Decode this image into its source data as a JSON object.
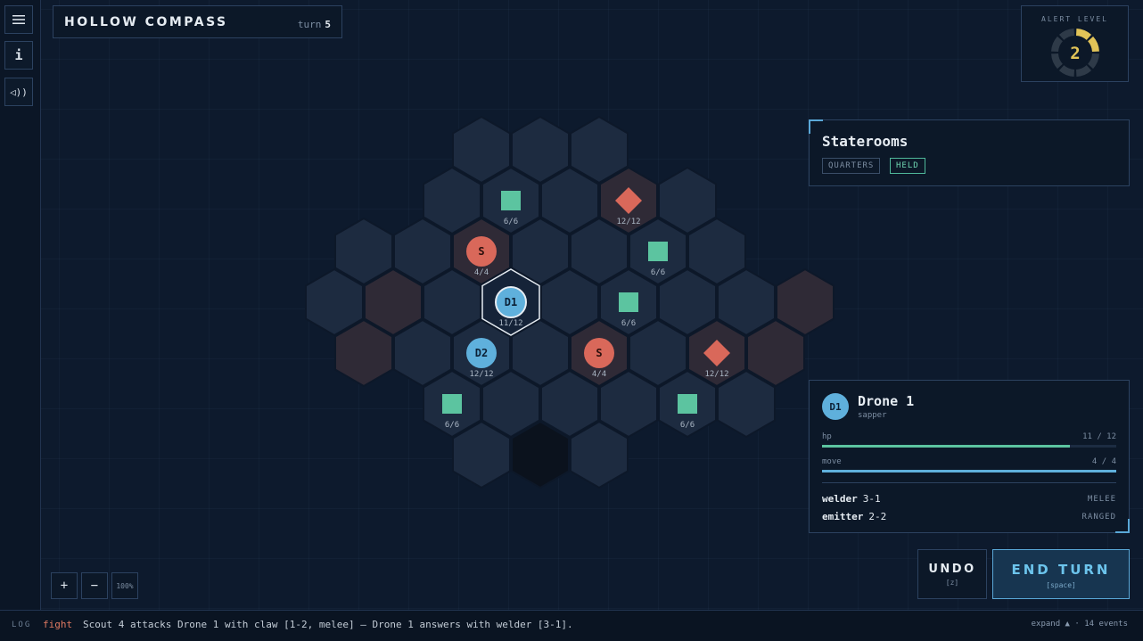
{
  "header": {
    "title": "HOLLOW COMPASS",
    "turn_label": "turn",
    "turn_value": "5"
  },
  "sidebar": {
    "menu_icon": "menu-icon",
    "info_label": "i",
    "sound_label": "◁))"
  },
  "alert": {
    "label": "ALERT LEVEL",
    "level": "2",
    "level_value": 2,
    "max": 8
  },
  "room": {
    "name": "Staterooms",
    "tags": [
      "QUARTERS",
      "HELD"
    ]
  },
  "selected_unit": {
    "badge": "D1",
    "name": "Drone 1",
    "role": "sapper",
    "hp_label": "hp",
    "hp_text": "11 / 12",
    "hp": 11,
    "hp_max": 12,
    "move_label": "move",
    "move_text": "4 / 4",
    "move": 4,
    "move_max": 4,
    "weapons": [
      {
        "name": "welder",
        "stat": "3-1",
        "type": "MELEE"
      },
      {
        "name": "emitter",
        "stat": "2-2",
        "type": "RANGED"
      }
    ]
  },
  "actions": {
    "undo_label": "UNDO",
    "undo_key": "[z]",
    "end_label": "END TURN",
    "end_key": "[space]"
  },
  "zoom": {
    "in_label": "+",
    "out_label": "−",
    "level": "100%"
  },
  "log": {
    "label": "LOG",
    "kind": "fight",
    "message": "Scout 4 attacks Drone 1 with claw [1-2, melee] — Drone 1 answers with welder [3-1].",
    "expand": "expand ▲ · 14 events"
  },
  "colors": {
    "hex_default": "#1d2b40",
    "hex_hostile": "#2f2a36",
    "hex_void": "#0b121d",
    "drone": "#5fb0dc",
    "scout": "#d9685a",
    "supply": "#5cc4a0",
    "hazard": "#d9685a"
  },
  "board": {
    "units": [
      {
        "id": "D1",
        "kind": "drone",
        "hp": "11/12",
        "selected": true
      },
      {
        "id": "D2",
        "kind": "drone",
        "hp": "12/12"
      },
      {
        "id": "S",
        "kind": "scout",
        "hp": "4/4"
      },
      {
        "id": "S",
        "kind": "scout",
        "hp": "4/4"
      }
    ],
    "objects": [
      {
        "kind": "supply",
        "hp": "6/6"
      },
      {
        "kind": "supply",
        "hp": "6/6"
      },
      {
        "kind": "supply",
        "hp": "6/6"
      },
      {
        "kind": "supply",
        "hp": "6/6"
      },
      {
        "kind": "supply",
        "hp": "6/6"
      },
      {
        "kind": "hazard",
        "hp": "12/12"
      },
      {
        "kind": "hazard",
        "hp": "12/12"
      }
    ]
  }
}
